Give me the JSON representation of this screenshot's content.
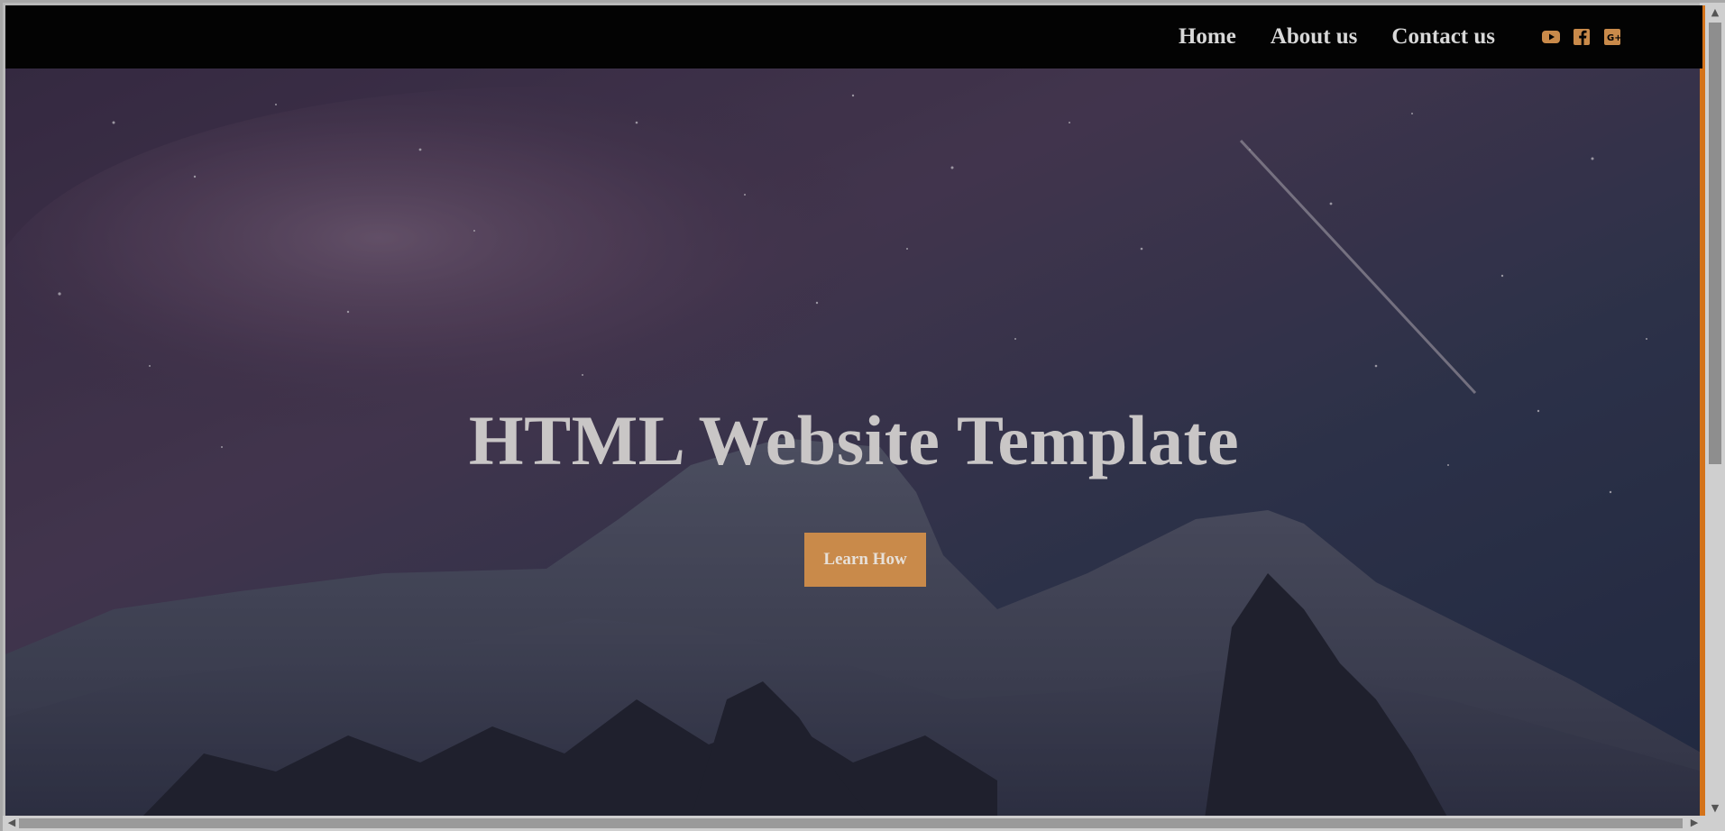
{
  "nav": {
    "links": [
      "Home",
      "About us",
      "Contact us"
    ],
    "social": [
      {
        "icon": "youtube-icon",
        "color": "#c98a4a"
      },
      {
        "icon": "facebook-icon",
        "color": "#c98a4a"
      },
      {
        "icon": "google-plus-icon",
        "color": "#c98a4a"
      }
    ]
  },
  "hero": {
    "title": "HTML Website Template",
    "cta_label": "Learn How",
    "accent_color": "#c98a4a"
  }
}
